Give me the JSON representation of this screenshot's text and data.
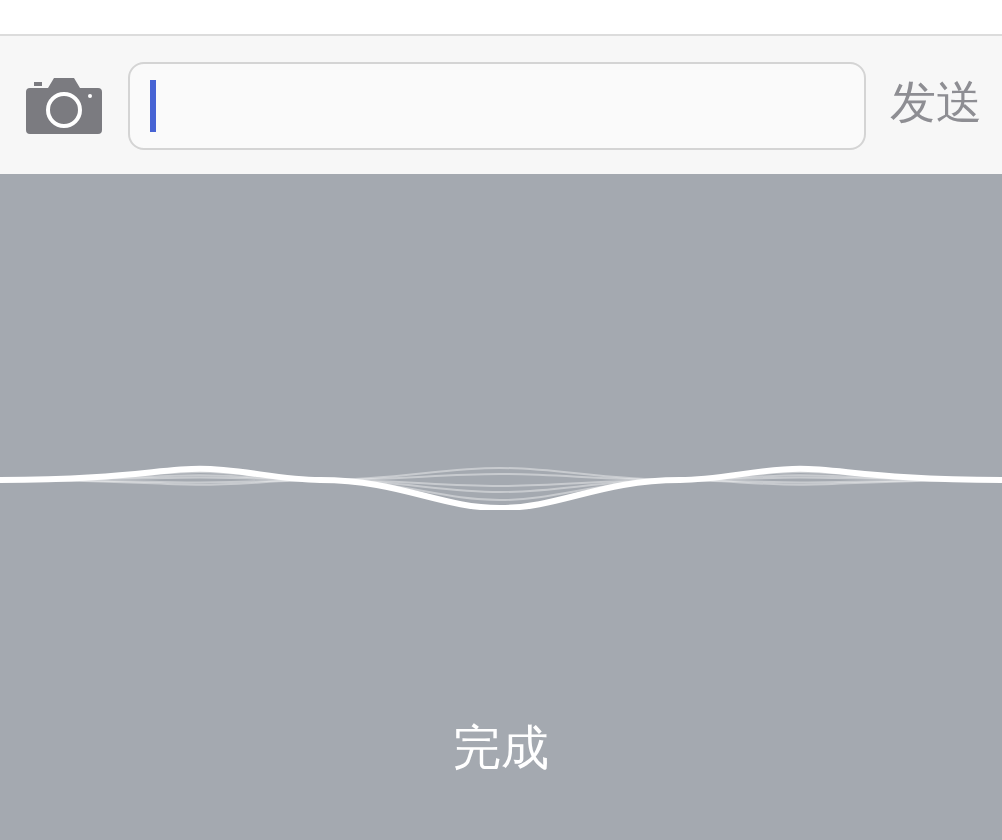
{
  "input_bar": {
    "text_field": {
      "focused": true
    },
    "send_button": "发送"
  },
  "dictation": {
    "done_button": "完成"
  }
}
